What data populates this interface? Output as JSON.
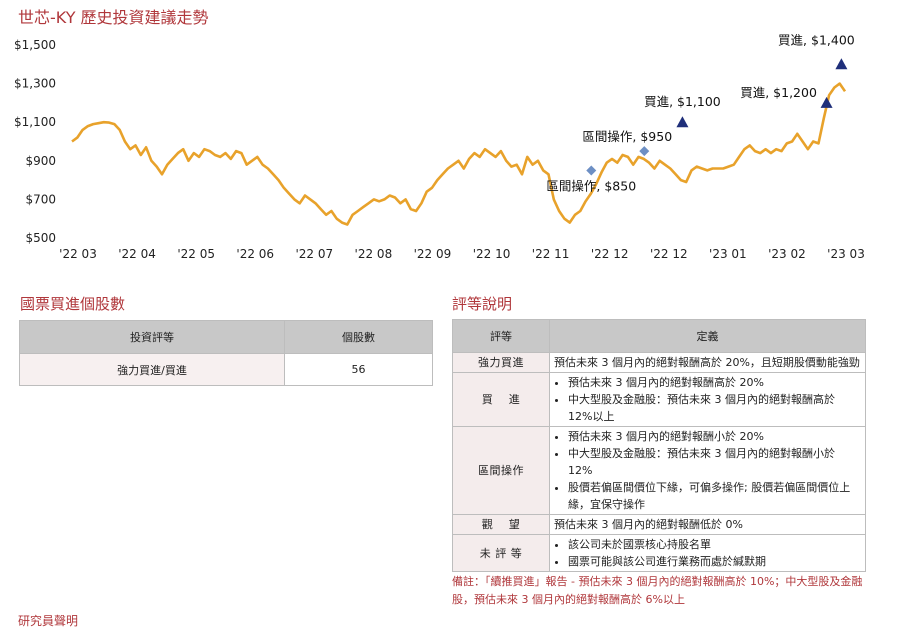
{
  "chart_data": {
    "type": "line",
    "title": "世芯-KY 歷史投資建議走勢",
    "y_ticks": [
      "$1,500",
      "$1,300",
      "$1,100",
      "$900",
      "$700",
      "$500"
    ],
    "ylim": [
      500,
      1500
    ],
    "x_ticks": [
      "'22 03",
      "'22 04",
      "'22 05",
      "'22 06",
      "'22 07",
      "'22 08",
      "'22 09",
      "'22 10",
      "'22 11",
      "'22 12",
      "'22 12",
      "'23 01",
      "'23 02",
      "'23 03"
    ],
    "grid": false,
    "line_color": "#e8a22b",
    "series": [
      {
        "values": [
          1000,
          1020,
          1060,
          1080,
          1090,
          1095,
          1100,
          1098,
          1090,
          1060,
          1000,
          960,
          980,
          930,
          970,
          900,
          870,
          830,
          880,
          910,
          940,
          960,
          900,
          940,
          920,
          960,
          950,
          930,
          920,
          940,
          910,
          950,
          940,
          880,
          900,
          920,
          880,
          860,
          830,
          800,
          760,
          730,
          700,
          680,
          720,
          700,
          680,
          650,
          620,
          640,
          600,
          580,
          570,
          620,
          640,
          660,
          680,
          700,
          690,
          700,
          720,
          710,
          680,
          700,
          650,
          640,
          680,
          740,
          760,
          800,
          830,
          860,
          880,
          900,
          860,
          910,
          940,
          920,
          960,
          940,
          920,
          950,
          900,
          870,
          880,
          830,
          920,
          880,
          900,
          850,
          830,
          700,
          640,
          600,
          580,
          620,
          640,
          690,
          730,
          780,
          840,
          890,
          910,
          890,
          930,
          920,
          880,
          920,
          910,
          890,
          860,
          900,
          880,
          860,
          830,
          800,
          790,
          850,
          870,
          860,
          850,
          860,
          860,
          860,
          870,
          880,
          920,
          960,
          980,
          950,
          940,
          960,
          940,
          960,
          950,
          990,
          1000,
          1040,
          1000,
          960,
          1000,
          990,
          1120,
          1240,
          1280,
          1300,
          1260
        ],
        "x_range": [
          "2022-03-01",
          "2023-03-04"
        ]
      }
    ],
    "markers": [
      {
        "label": "區間操作, $850",
        "date": "2022-11-01",
        "value": 850,
        "shape": "diamond",
        "color": "#6d8fc4"
      },
      {
        "label": "區間操作, $950",
        "date": "2022-11-26",
        "value": 950,
        "shape": "diamond",
        "color": "#6d8fc4"
      },
      {
        "label": "買進, $1,100",
        "date": "2022-12-14",
        "value": 1100,
        "shape": "triangle",
        "color": "#1f2f7a"
      },
      {
        "label": "買進, $1,200",
        "date": "2023-02-20",
        "value": 1200,
        "shape": "triangle",
        "color": "#1f2f7a"
      },
      {
        "label": "買進, $1,400",
        "date": "2023-02-27",
        "value": 1400,
        "shape": "triangle",
        "color": "#1f2f7a"
      }
    ]
  },
  "holdings": {
    "title": "國票買進個股數",
    "headers": [
      "投資評等",
      "個股數"
    ],
    "row": [
      "強力買進/買進",
      "56"
    ]
  },
  "ratings": {
    "title": "評等說明",
    "headers": [
      "評等",
      "定義"
    ],
    "strong_buy": {
      "name": "強力買進",
      "def": "預估未來 3 個月內的絕對報酬高於 20%，且短期股價動能強勁"
    },
    "buy": {
      "name": "買　 進",
      "items": [
        "預估未來 3 個月內的絕對報酬高於 20%",
        "中大型股及金融股：預估未來  3 個月內的絕對報酬高於 12%以上"
      ]
    },
    "trading": {
      "name": "區間操作",
      "items": [
        "預估未來 3 個月內的絕對報酬小於 20%",
        "中大型股及金融股：預估未來  3 個月內的絕對報酬小於 12%",
        "股價若偏區間價位下緣，可偏多操作; 股價若偏區間價位上緣，宜保守操作"
      ]
    },
    "watch": {
      "name": "觀　 望",
      "def": "預估未來 3 個月內的絕對報酬低於 0%"
    },
    "not_rated": {
      "name": "未 評 等",
      "items": [
        "該公司未於國票核心持股名單",
        "國票可能與該公司進行業務而處於緘默期"
      ]
    }
  },
  "note": "備註：「續推買進」報告 - 預估未來 3 個月內的絕對報酬高於 10%；中大型股及金融股，預估未來 3 個月內的絕對報酬高於 6%以上",
  "footer": "研究員聲明"
}
